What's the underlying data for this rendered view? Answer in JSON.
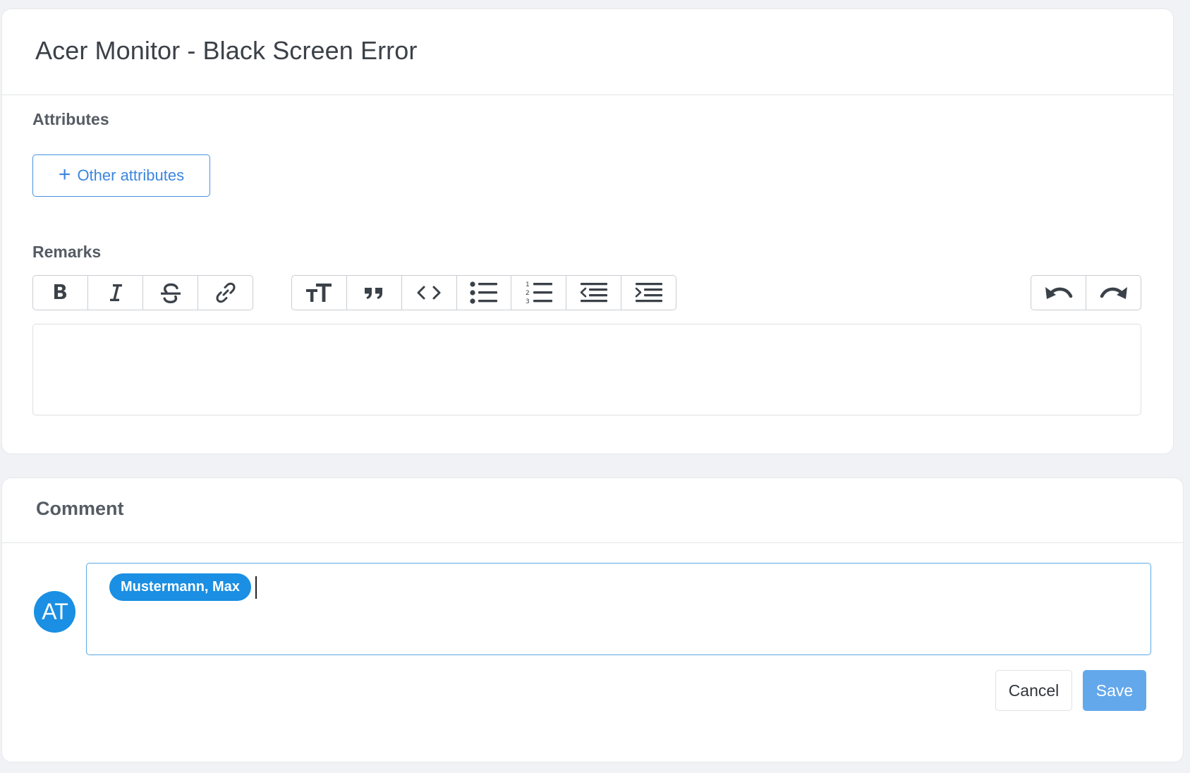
{
  "ticket": {
    "title": "Acer Monitor - Black Screen Error",
    "attributes_label": "Attributes",
    "other_attributes_button": "Other attributes",
    "remarks_label": "Remarks",
    "remarks_value": ""
  },
  "toolbar": {
    "format_group": [
      "bold-icon",
      "italic-icon",
      "strikethrough-icon",
      "link-icon"
    ],
    "block_group": [
      "heading-icon",
      "quote-icon",
      "code-icon",
      "bullet-list-icon",
      "numbered-list-icon",
      "outdent-icon",
      "indent-icon"
    ],
    "history_group": [
      "undo-icon",
      "redo-icon"
    ]
  },
  "comment": {
    "title": "Comment",
    "avatar_initials": "AT",
    "mention": "Mustermann, Max",
    "cancel_label": "Cancel",
    "save_label": "Save"
  },
  "colors": {
    "accent": "#1a8fe3",
    "save_button": "#64a8ec",
    "outline_button": "#4a90e2",
    "background": "#f1f2f5"
  }
}
